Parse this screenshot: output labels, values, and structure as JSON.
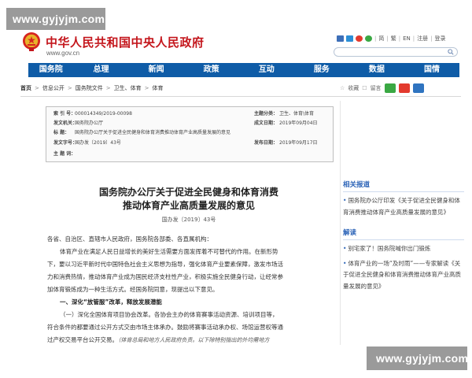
{
  "watermark": {
    "top": "www.gyjyjm.com",
    "bottom": "www.gyjyjm.com"
  },
  "header": {
    "title": "中华人民共和国中央人民政府",
    "url": "www.gov.cn",
    "links": [
      "简",
      "繁",
      "EN",
      "注册",
      "登录"
    ],
    "search_placeholder": ""
  },
  "nav": [
    "国务院",
    "总理",
    "新闻",
    "政策",
    "互动",
    "服务",
    "数据",
    "国情"
  ],
  "breadcrumb": {
    "items": [
      "首页",
      "信息公开",
      "国务院文件",
      "卫生、体育",
      "体育"
    ],
    "tools": [
      "收藏",
      "留言"
    ]
  },
  "meta": {
    "index_label": "索 引 号：",
    "index_value": "000014349/2019-00098",
    "subject_label": "主题分类：",
    "subject_value": "卫生、体育\\体育",
    "issuer_label": "发文机关：",
    "issuer_value": "国务院办公厅",
    "written_label": "成文日期：",
    "written_value": "2019年09月04日",
    "title_label": "标      题：",
    "title_value": "国务院办公厅关于促进全民健身和体育消费推动体育产业高质量发展的意见",
    "docno_label": "发文字号：",
    "docno_value": "国办发〔2019〕43号",
    "pub_label": "发布日期：",
    "pub_value": "2019年09月17日",
    "keywords_label": "主 题 词：",
    "keywords_value": ""
  },
  "document": {
    "title_line1": "国务院办公厅关于促进全民健身和体育消费",
    "title_line2": "推动体育产业高质量发展的意见",
    "number": "国办发〔2019〕43号",
    "salutation": "各省、自治区、直辖市人民政府，国务院各部委、各直属机构：",
    "p1_l1": "体育产业在满足人民日益增长的美好生活需要方面发挥着不可替代的作用。在新形势",
    "p1_l2": "下，要以习近平新时代中国特色社会主义思想为指导，强化体育产业要素保障，激发市场活",
    "p1_l3": "力和消费热情，推动体育产业成为国民经济支柱性产业，积极实施全民健身行动，让经常参",
    "p1_l4": "加体育锻炼成为一种生活方式。经国务院同意，现提出以下意见。",
    "section1": "一、深化“放管服”改革，释放发展潜能",
    "p2_l1": "（一）深化全国体育项目协会改革。各协会主办的体育赛事活动资源、培训项目等，",
    "p2_l2": "符合条件的都要通过公开方式交由市场主体承办。鼓励将赛事活动承办权、场馆运营权等通",
    "p2_l3": "过产权交易平台公开交易。",
    "p2_note": "（体育总局和地方人民政府负责。以下除特别指出的外均需地方"
  },
  "sidebar": {
    "related_head": "相关报道",
    "related_items": [
      "国务院办公厅印发《关于促进全民健身和体育消费推动体育产业高质量发展的意见》"
    ],
    "interpret_head": "解读",
    "interpret_items": [
      "别宅家了！国务院喊你出门锻炼",
      "体育产业的一场“及时雨”——专家解读《关于促进全民健身和体育消费推动体育产业高质量发展的意见》"
    ]
  },
  "colors": {
    "brand_red": "#c4161c",
    "nav_blue": "#0f5ca7",
    "link_blue": "#2b63b7"
  }
}
